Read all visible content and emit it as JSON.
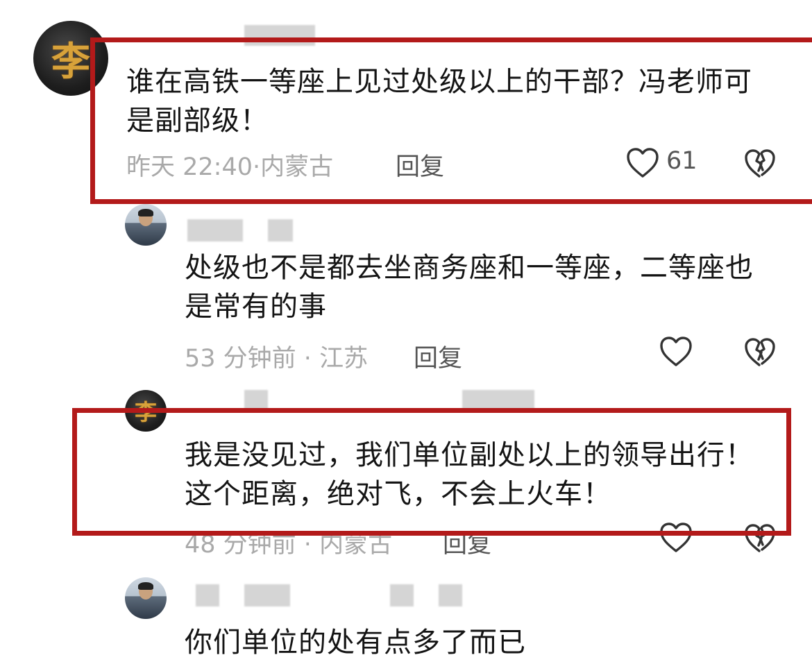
{
  "comments": [
    {
      "text": "谁在高铁一等座上见过处级以上的干部？冯老师可是副部级！",
      "time": "昨天 22:40",
      "location": "内蒙古",
      "reply_label": "回复",
      "likes": "61",
      "avatar_char": "李"
    },
    {
      "text": "处级也不是都去坐商务座和一等座，二等座也是常有的事",
      "time": "53 分钟前",
      "location": "江苏",
      "reply_label": "回复"
    },
    {
      "text": "我是没见过，我们单位副处以上的领导出行！这个距离，绝对飞，不会上火车！",
      "time": "48 分钟前",
      "location": "内蒙古",
      "reply_label": "回复",
      "avatar_char": "李"
    },
    {
      "text": "你们单位的处有点多了而已"
    }
  ],
  "icons": {
    "like": "heart-outline-icon",
    "dislike": "broken-heart-icon"
  },
  "colors": {
    "highlight_border": "#b31a1a",
    "meta_text": "#a9a9a9",
    "avatar_gold": "#d8a23a"
  }
}
